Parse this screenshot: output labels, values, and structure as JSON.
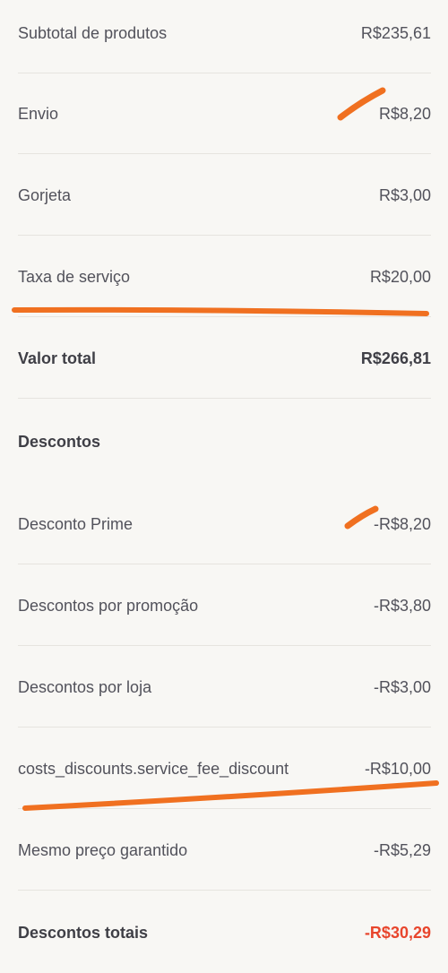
{
  "summary": {
    "rows": [
      {
        "label": "Subtotal de produtos",
        "value": "R$235,61"
      },
      {
        "label": "Envio",
        "value": "R$8,20"
      },
      {
        "label": "Gorjeta",
        "value": "R$3,00"
      },
      {
        "label": "Taxa de serviço",
        "value": "R$20,00"
      }
    ],
    "total": {
      "label": "Valor total",
      "value": "R$266,81"
    }
  },
  "discounts": {
    "title": "Descontos",
    "rows": [
      {
        "label": "Desconto Prime",
        "value": "-R$8,20"
      },
      {
        "label": "Descontos por promoção",
        "value": "-R$3,80"
      },
      {
        "label": "Descontos por loja",
        "value": "-R$3,00"
      },
      {
        "label": "costs_discounts.service_fee_discount",
        "value": "-R$10,00"
      },
      {
        "label": "Mesmo preço garantido",
        "value": "-R$5,29"
      }
    ],
    "total": {
      "label": "Descontos totais",
      "value": "-R$30,29"
    }
  },
  "colors": {
    "background": "#f8f7f4",
    "annotation": "#f07020",
    "discount_total": "#e8452c"
  }
}
